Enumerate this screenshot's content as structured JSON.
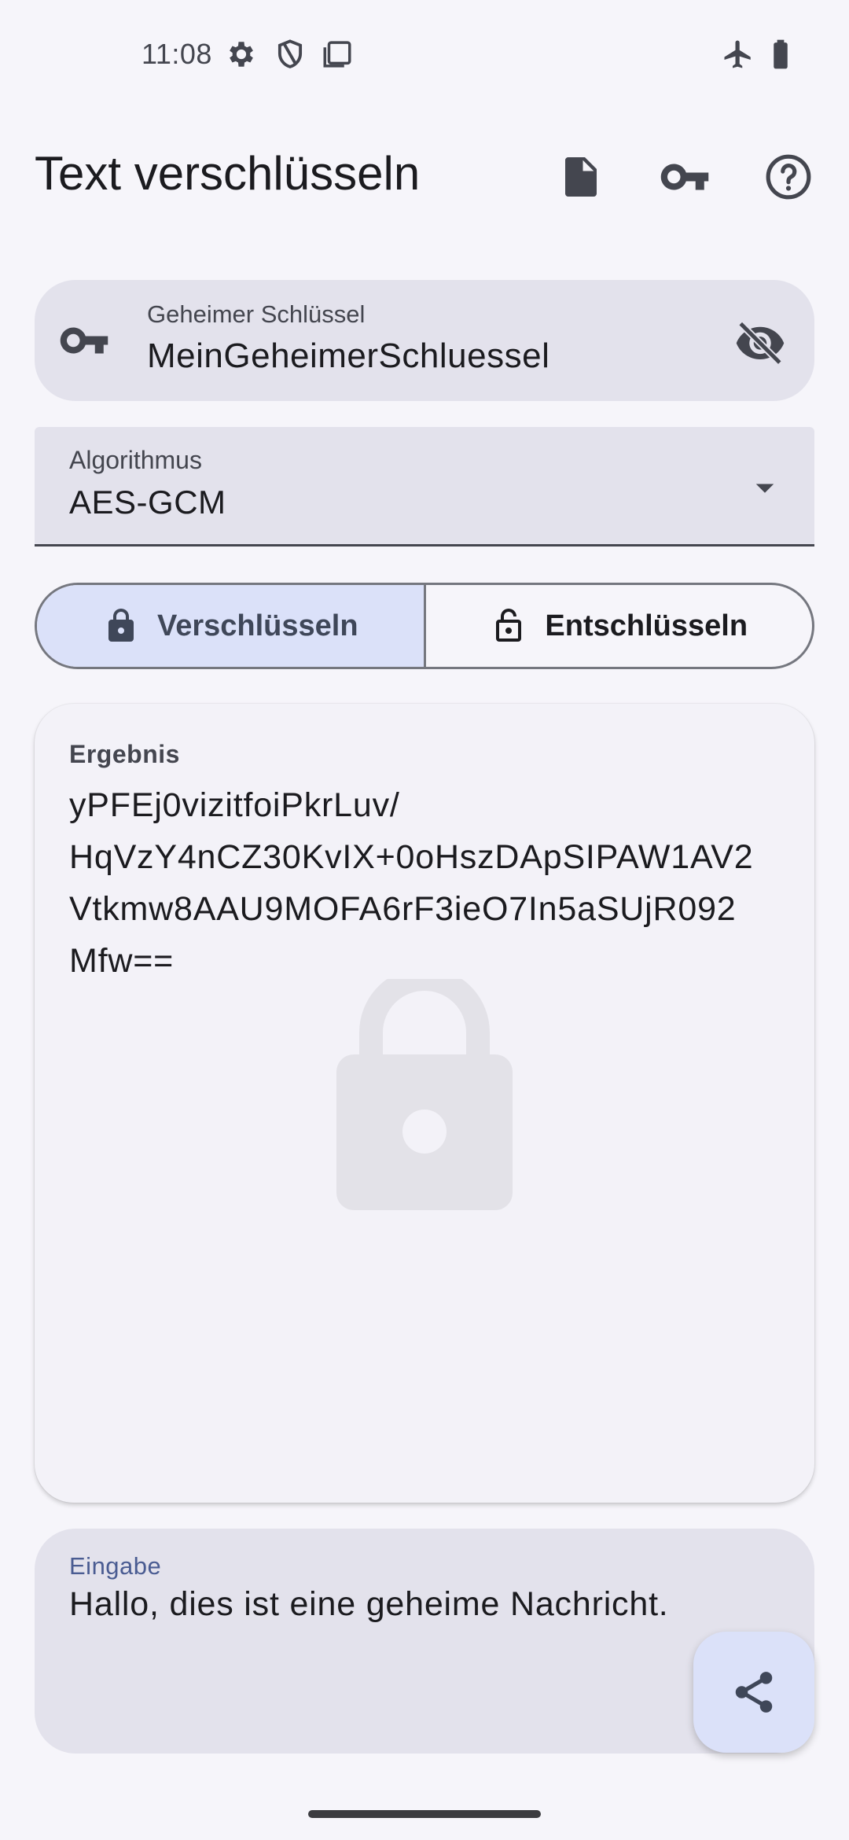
{
  "status_bar": {
    "time": "11:08",
    "left_icons": [
      "gear-icon",
      "shield-icon",
      "screenshot-icon"
    ],
    "right_icons": [
      "airplane-icon",
      "battery-icon"
    ]
  },
  "app_bar": {
    "title": "Text verschlüsseln",
    "actions": [
      "file-icon",
      "key-icon",
      "help-icon"
    ]
  },
  "secret_key": {
    "label": "Geheimer Schlüssel",
    "value": "MeinGeheimerSchluessel"
  },
  "algorithm": {
    "label": "Algorithmus",
    "selected": "AES-GCM"
  },
  "mode_toggle": {
    "encrypt_label": "Verschlüsseln",
    "decrypt_label": "Entschlüsseln",
    "active": "encrypt"
  },
  "result": {
    "label": "Ergebnis",
    "value": "yPFEj0vizitfoiPkrLuv/\nHqVzY4nCZ30KvIX+0oHszDApSIPAW1AV2\nVtkmw8AAU9MOFA6rF3ieO7In5aSUjR092\nMfw=="
  },
  "input": {
    "label": "Eingabe",
    "value": "Hallo, dies ist eine geheime Nachricht."
  },
  "colors": {
    "accent_container": "#dbe1f9",
    "field_bg": "#e3e2ec",
    "label_accent": "#4a5c92"
  }
}
